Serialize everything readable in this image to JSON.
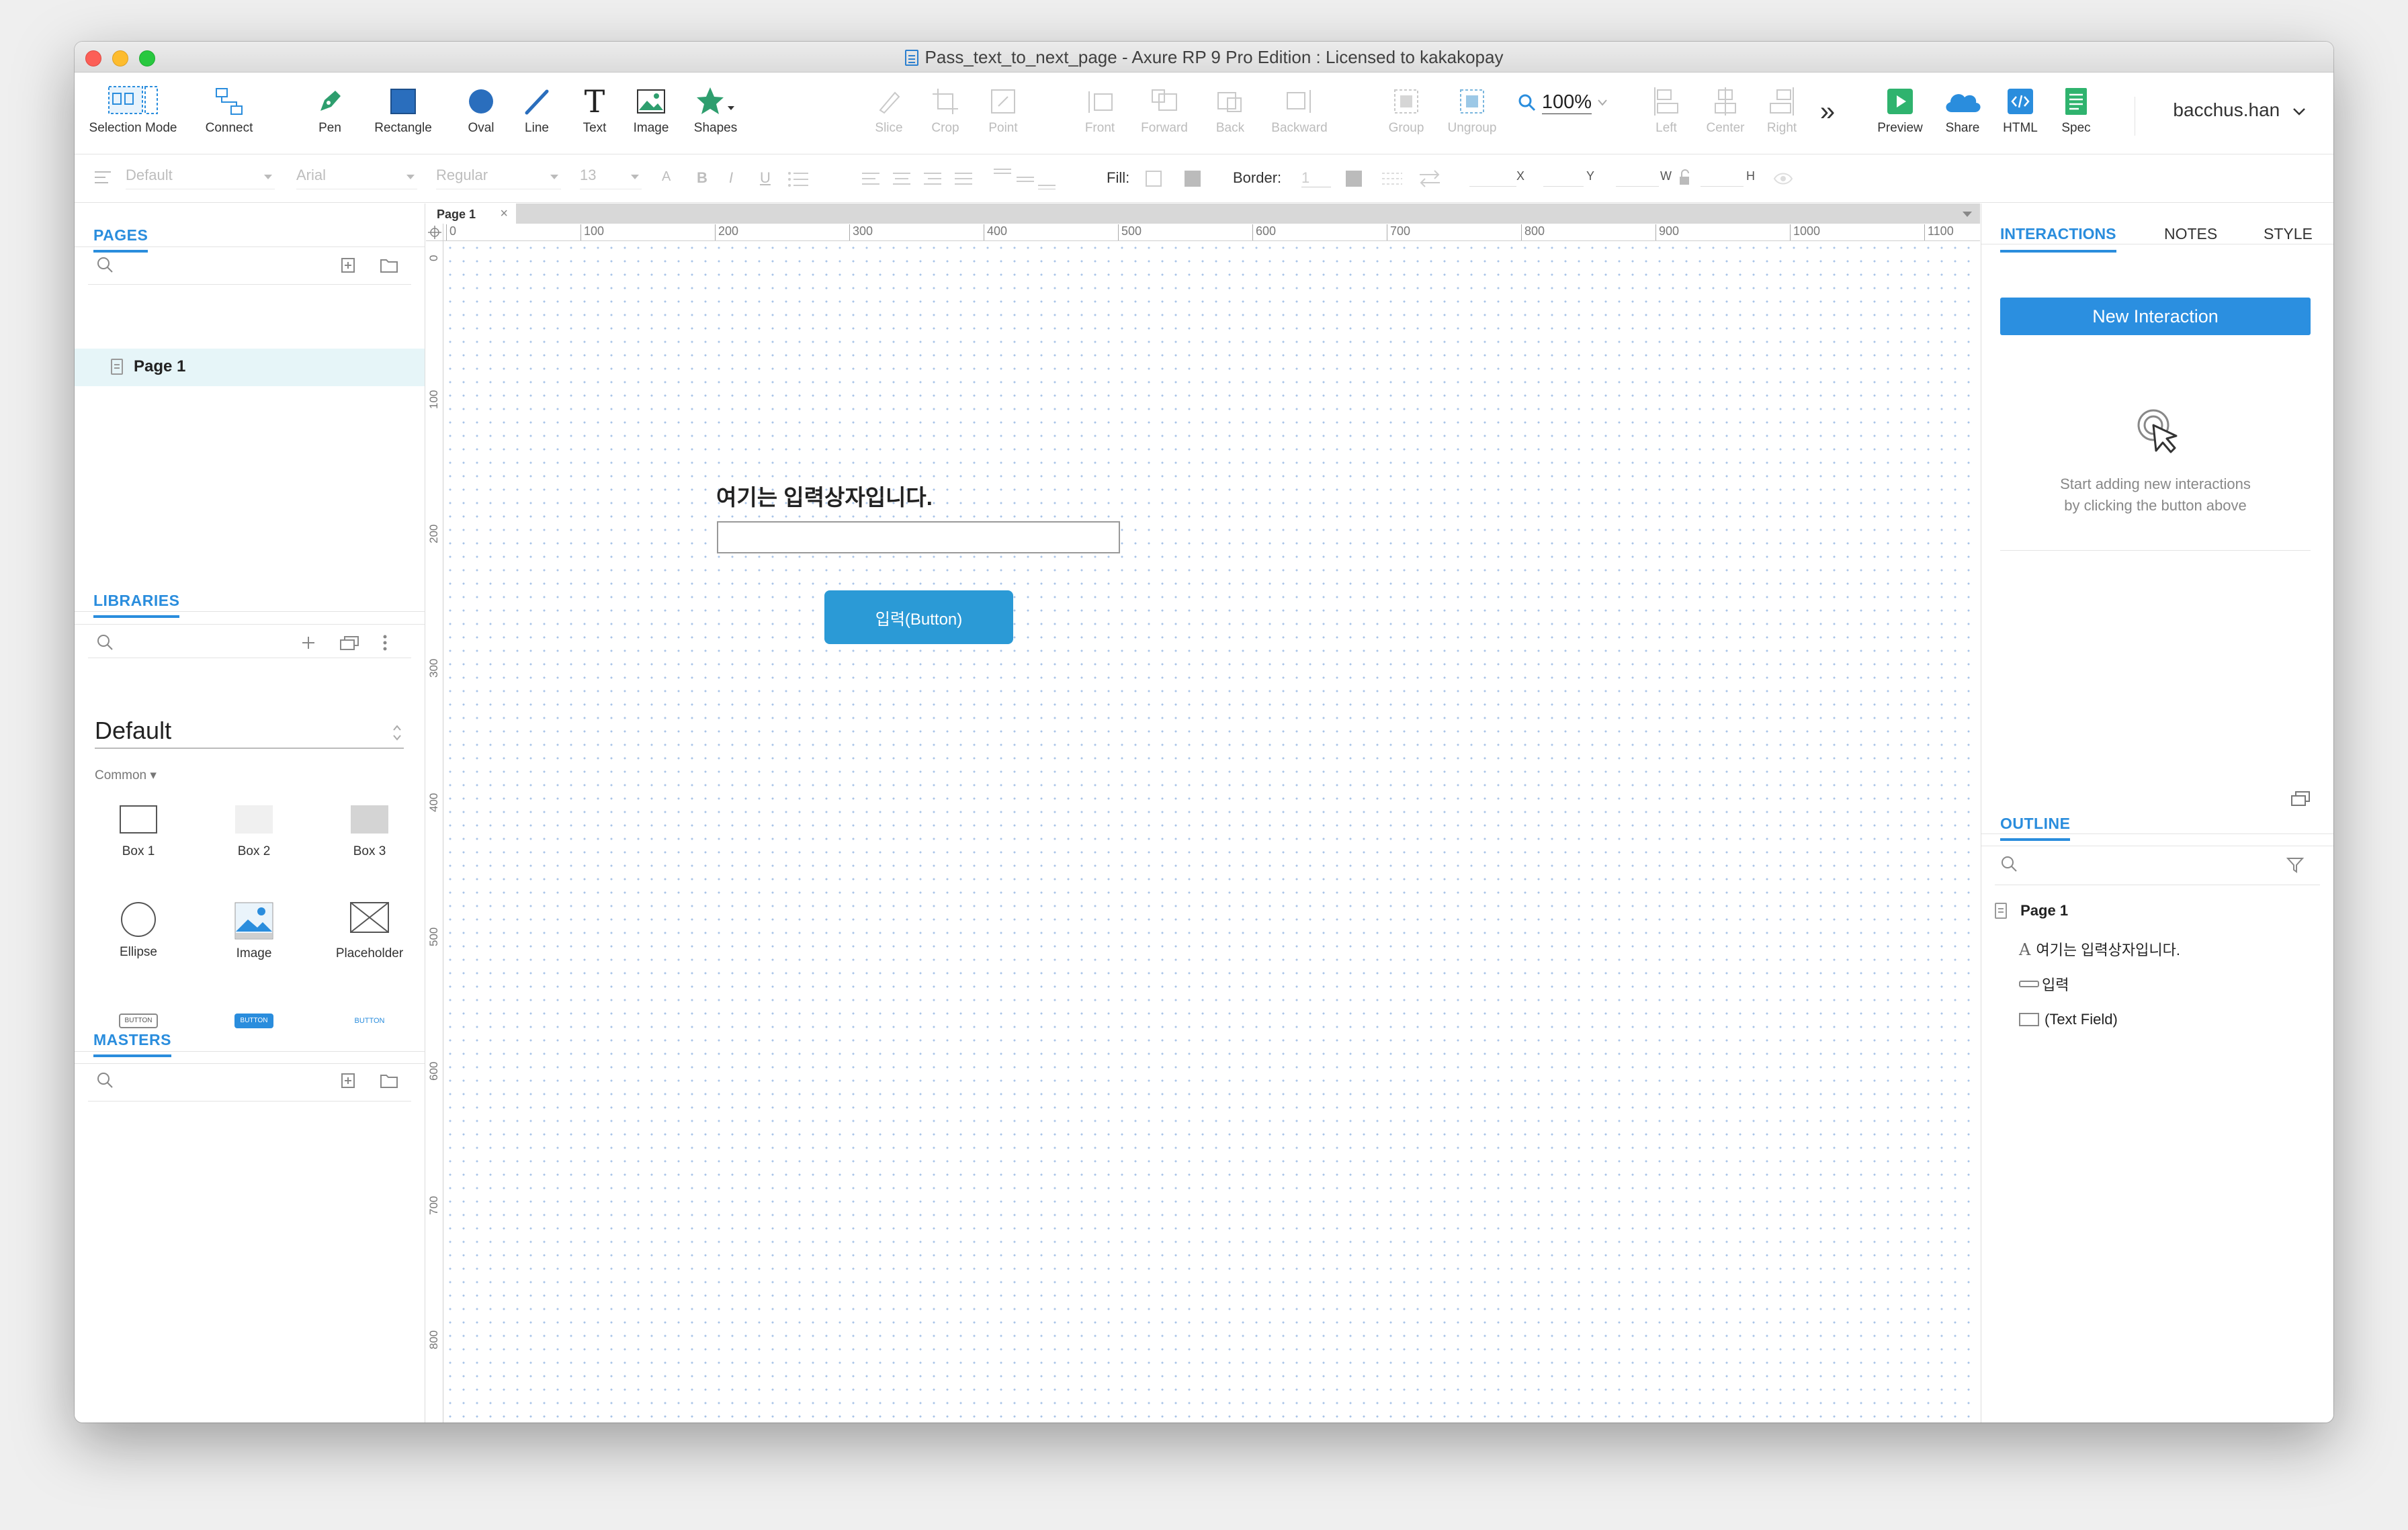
{
  "window": {
    "title": "Pass_text_to_next_page - Axure RP 9 Pro Edition : Licensed to kakakopay"
  },
  "toolbar": {
    "selection_mode": "Selection Mode",
    "connect": "Connect",
    "pen": "Pen",
    "rectangle": "Rectangle",
    "oval": "Oval",
    "line": "Line",
    "text": "Text",
    "image": "Image",
    "shapes": "Shapes",
    "slice": "Slice",
    "crop": "Crop",
    "point": "Point",
    "front": "Front",
    "forward": "Forward",
    "back": "Back",
    "backward": "Backward",
    "group": "Group",
    "ungroup": "Ungroup",
    "zoom": "100%",
    "left": "Left",
    "center": "Center",
    "right": "Right",
    "more": "»",
    "preview": "Preview",
    "share": "Share",
    "html": "HTML",
    "spec": "Spec",
    "user": "bacchus.han"
  },
  "formatbar": {
    "style": "Default",
    "font": "Arial",
    "weight": "Regular",
    "size": "13",
    "fill_label": "Fill:",
    "border_label": "Border:",
    "border_value": "1",
    "x": "X",
    "y": "Y",
    "w": "W",
    "h": "H"
  },
  "pages": {
    "header": "PAGES",
    "items": [
      "Page 1"
    ]
  },
  "libraries": {
    "header": "LIBRARIES",
    "selected": "Default",
    "category": "Common ▾",
    "widgets": [
      "Box 1",
      "Box 2",
      "Box 3",
      "Ellipse",
      "Image",
      "Placeholder"
    ],
    "button_labels": [
      "BUTTON",
      "BUTTON",
      "BUTTON"
    ]
  },
  "masters": {
    "header": "MASTERS"
  },
  "canvas": {
    "tab": "Page 1",
    "ruler_h": [
      "0",
      "100",
      "200",
      "300",
      "400",
      "500",
      "600",
      "700",
      "800",
      "900",
      "1000",
      "1100"
    ],
    "ruler_v": [
      "0",
      "100",
      "200",
      "300",
      "400",
      "500",
      "600",
      "700",
      "800"
    ],
    "label_text": "여기는 입력상자입니다.",
    "button_text": "입력(Button)"
  },
  "right_panel": {
    "tabs": [
      "INTERACTIONS",
      "NOTES",
      "STYLE"
    ],
    "new_interaction": "New Interaction",
    "hint_line1": "Start adding new interactions",
    "hint_line2": "by clicking the button above"
  },
  "outline": {
    "header": "OUTLINE",
    "page": "Page 1",
    "items": [
      "여기는 입력상자입니다.",
      "입력",
      "(Text Field)"
    ]
  }
}
